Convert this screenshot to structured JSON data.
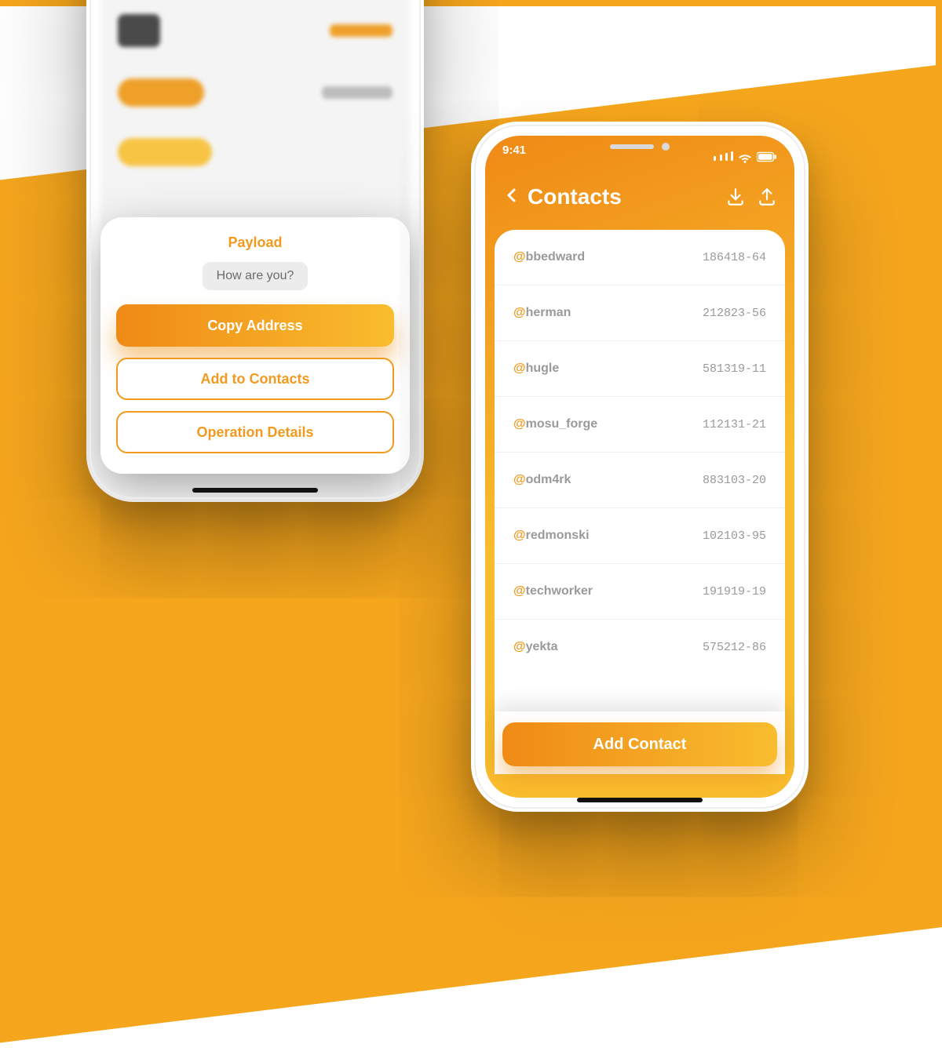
{
  "left": {
    "sheet": {
      "title": "Payload",
      "chip": "How are you?",
      "primary": "Copy Address",
      "contacts": "Add to Contacts",
      "details": "Operation Details"
    }
  },
  "right": {
    "status": {
      "time": "9:41"
    },
    "header": {
      "title": "Contacts"
    },
    "cta": "Add Contact",
    "contacts": [
      {
        "handle": "bbedward",
        "id": "186418-64"
      },
      {
        "handle": "herman",
        "id": "212823-56"
      },
      {
        "handle": "hugle",
        "id": "581319-11"
      },
      {
        "handle": "mosu_forge",
        "id": "112131-21"
      },
      {
        "handle": "odm4rk",
        "id": "883103-20"
      },
      {
        "handle": "redmonski",
        "id": "102103-95"
      },
      {
        "handle": "techworker",
        "id": "191919-19"
      },
      {
        "handle": "yekta",
        "id": "575212-86"
      }
    ]
  }
}
